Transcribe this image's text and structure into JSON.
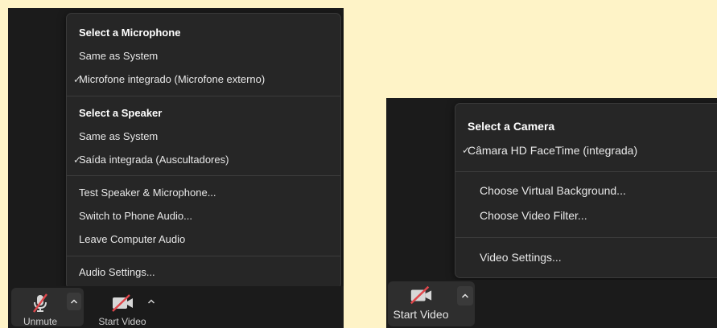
{
  "left_panel": {
    "menu": {
      "microphone_header": "Select a Microphone",
      "microphone_items": [
        "Same as System",
        "Microfone integrado (Microfone externo)"
      ],
      "speaker_header": "Select a Speaker",
      "speaker_items": [
        "Same as System",
        "Saída integrada (Auscultadores)"
      ],
      "actions": [
        "Test Speaker & Microphone...",
        "Switch to Phone Audio...",
        "Leave Computer Audio"
      ],
      "settings": "Audio Settings..."
    },
    "toolbar": {
      "unmute_label": "Unmute",
      "start_video_label": "Start Video"
    }
  },
  "right_panel": {
    "menu": {
      "camera_header": "Select a Camera",
      "camera_items": [
        "Câmara HD FaceTime (integrada)"
      ],
      "actions": [
        "Choose Virtual Background...",
        "Choose Video Filter..."
      ],
      "settings": "Video Settings..."
    },
    "toolbar": {
      "start_video_label": "Start Video"
    }
  },
  "checkmark": "✓",
  "icons": {
    "microphone": "microphone-muted-icon",
    "camera": "camera-off-icon",
    "caret": "chevron-up-icon"
  },
  "colors": {
    "background": "#fef3c7",
    "panel": "#1b1b1b",
    "menu": "#262626",
    "mute_slash": "#e0474c"
  }
}
